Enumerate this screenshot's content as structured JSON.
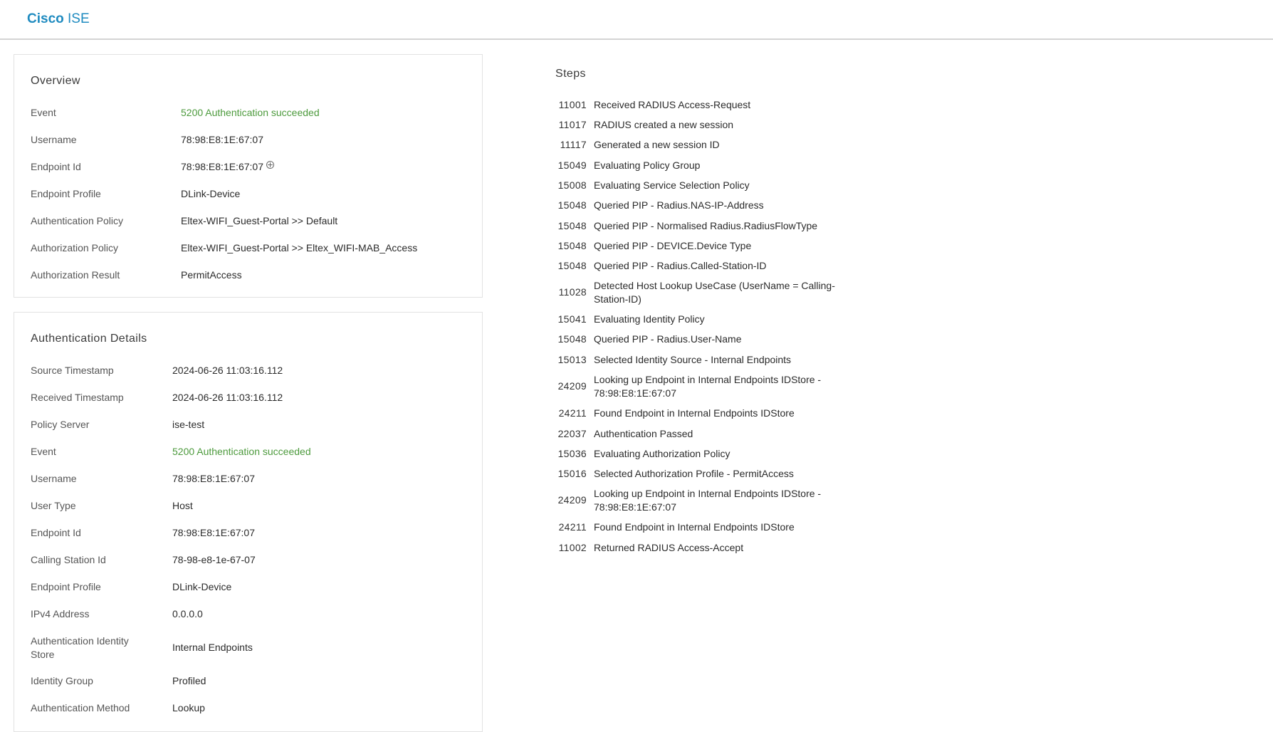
{
  "app": {
    "brand_bold": "Cisco",
    "brand_light": "ISE"
  },
  "overview": {
    "title": "Overview",
    "rows": [
      {
        "label": "Event",
        "value": "5200 Authentication succeeded"
      },
      {
        "label": "Username",
        "value": "78:98:E8:1E:67:07"
      },
      {
        "label": "Endpoint Id",
        "value": "78:98:E8:1E:67:07"
      },
      {
        "label": "Endpoint Profile",
        "value": "DLink-Device"
      },
      {
        "label": "Authentication Policy",
        "value": "Eltex-WIFI_Guest-Portal >> Default"
      },
      {
        "label": "Authorization Policy",
        "value": "Eltex-WIFI_Guest-Portal >> Eltex_WIFI-MAB_Access"
      },
      {
        "label": "Authorization Result",
        "value": "PermitAccess"
      }
    ]
  },
  "auth_details": {
    "title": "Authentication Details",
    "rows": [
      {
        "label": "Source Timestamp",
        "value": "2024-06-26 11:03:16.112"
      },
      {
        "label": "Received Timestamp",
        "value": "2024-06-26 11:03:16.112"
      },
      {
        "label": "Policy Server",
        "value": "ise-test"
      },
      {
        "label": "Event",
        "value": "5200 Authentication succeeded"
      },
      {
        "label": "Username",
        "value": "78:98:E8:1E:67:07"
      },
      {
        "label": "User Type",
        "value": "Host"
      },
      {
        "label": "Endpoint Id",
        "value": "78:98:E8:1E:67:07"
      },
      {
        "label": "Calling Station Id",
        "value": "78-98-e8-1e-67-07"
      },
      {
        "label": "Endpoint Profile",
        "value": "DLink-Device"
      },
      {
        "label": "IPv4 Address",
        "value": "0.0.0.0"
      },
      {
        "label": "Authentication Identity Store",
        "value": "Internal Endpoints"
      },
      {
        "label": "Identity Group",
        "value": "Profiled"
      },
      {
        "label": "Authentication Method",
        "value": "Lookup"
      }
    ]
  },
  "steps": {
    "title": "Steps",
    "items": [
      {
        "code": "11001",
        "text": "Received RADIUS Access-Request"
      },
      {
        "code": "11017",
        "text": "RADIUS created a new session"
      },
      {
        "code": "11117",
        "text": "Generated a new session ID"
      },
      {
        "code": "15049",
        "text": "Evaluating Policy Group"
      },
      {
        "code": "15008",
        "text": "Evaluating Service Selection Policy"
      },
      {
        "code": "15048",
        "text": "Queried PIP - Radius.NAS-IP-Address"
      },
      {
        "code": "15048",
        "text": "Queried PIP - Normalised Radius.RadiusFlowType"
      },
      {
        "code": "15048",
        "text": "Queried PIP - DEVICE.Device Type"
      },
      {
        "code": "15048",
        "text": "Queried PIP - Radius.Called-Station-ID"
      },
      {
        "code": "11028",
        "text": "Detected Host Lookup UseCase (UserName = Calling-Station-ID)"
      },
      {
        "code": "15041",
        "text": "Evaluating Identity Policy"
      },
      {
        "code": "15048",
        "text": "Queried PIP - Radius.User-Name"
      },
      {
        "code": "15013",
        "text": "Selected Identity Source - Internal Endpoints"
      },
      {
        "code": "24209",
        "text": "Looking up Endpoint in Internal Endpoints IDStore - 78:98:E8:1E:67:07"
      },
      {
        "code": "24211",
        "text": "Found Endpoint in Internal Endpoints IDStore"
      },
      {
        "code": "22037",
        "text": "Authentication Passed"
      },
      {
        "code": "15036",
        "text": "Evaluating Authorization Policy"
      },
      {
        "code": "15016",
        "text": "Selected Authorization Profile - PermitAccess"
      },
      {
        "code": "24209",
        "text": "Looking up Endpoint in Internal Endpoints IDStore - 78:98:E8:1E:67:07"
      },
      {
        "code": "24211",
        "text": "Found Endpoint in Internal Endpoints IDStore"
      },
      {
        "code": "11002",
        "text": "Returned RADIUS Access-Accept"
      }
    ]
  },
  "colors": {
    "brand": "#1f8bc0",
    "success": "#4c9a3c"
  }
}
